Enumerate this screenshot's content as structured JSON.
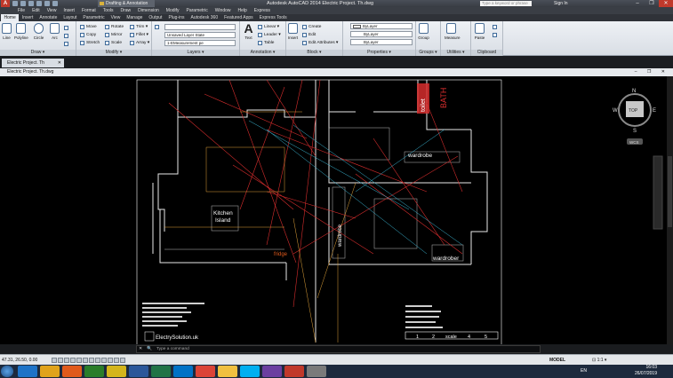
{
  "window": {
    "title": "Autodesk AutoCAD 2014   Electric Project. Th.dwg",
    "workspace": "Drafting & Annotation",
    "search_placeholder": "Type a keyword or phrase",
    "signin": "Sign In",
    "controls": [
      "–",
      "❐",
      "✕"
    ]
  },
  "menubar": [
    "File",
    "Edit",
    "View",
    "Insert",
    "Format",
    "Tools",
    "Draw",
    "Dimension",
    "Modify",
    "Parametric",
    "Window",
    "Help",
    "Express"
  ],
  "ribbon_tabs": [
    "Home",
    "Insert",
    "Annotate",
    "Layout",
    "Parametric",
    "View",
    "Manage",
    "Output",
    "Plug-ins",
    "Autodesk 360",
    "Featured Apps",
    "Express Tools"
  ],
  "ribbon": {
    "draw": {
      "title": "Draw ▾",
      "line": "Line",
      "polyline": "Polyline",
      "circle": "Circle",
      "arc": "Arc"
    },
    "modify": {
      "title": "Modify ▾",
      "move": "Move",
      "rotate": "Rotate",
      "trim": "Trim ▾",
      "copy": "Copy",
      "mirror": "Mirror",
      "fillet": "Fillet ▾",
      "stretch": "Stretch",
      "scale": "Scale",
      "array": "Array ▾"
    },
    "layers": {
      "title": "Layers ▾",
      "state": "Unsaved Layer State",
      "current": "1-EMeasurement pe"
    },
    "annotation": {
      "title": "Annotation ▾",
      "text": "Text",
      "linear": "Linear ▾",
      "leader": "Leader ▾",
      "table": "Table"
    },
    "block": {
      "title": "Block ▾",
      "insert": "Insert",
      "create": "Create",
      "edit": "Edit",
      "edit_attributes": "Edit Attributes ▾"
    },
    "properties": {
      "title": "Properties ▾",
      "color": "ByLayer",
      "linetype": "ByLayer",
      "lineweight": "ByLayer"
    },
    "groups": {
      "title": "Groups ▾",
      "group": "Group"
    },
    "utilities": {
      "title": "Utilities ▾",
      "measure": "Measure"
    },
    "clipboard": {
      "title": "Clipboard",
      "paste": "Paste"
    }
  },
  "doc_tab": {
    "label": "Electric Project. Th",
    "close": "✕"
  },
  "drawing": {
    "title": "Electric Project. Th.dwg",
    "window_controls": "– ❐ ✕",
    "labels": {
      "toilet": "toilet",
      "bath": "BATH",
      "wardrobe1": "wardrobe",
      "wardrobe2": "wardrobe",
      "wardrobe3": "wardrober",
      "kitchen": "Kitchen",
      "island": "Island",
      "fridge": "fridge",
      "brand": "ElectrySolution.uk"
    },
    "scale_bar": [
      "1",
      "2",
      "scale",
      "4",
      "5"
    ],
    "viewcube": {
      "n": "N",
      "s": "S",
      "e": "E",
      "w": "W",
      "top": "TOP",
      "wcs": "WCS"
    }
  },
  "command": {
    "placeholder": "Type a command",
    "buttons": "✕ 🔍"
  },
  "status": {
    "coords": "47.31, 26.50, 0.00",
    "model": "MODEL",
    "scale": "⊡ 1:1 ▾"
  },
  "taskbar": {
    "apps": [
      "ie",
      "explorer",
      "media",
      "chrome-alt",
      "paint",
      "word",
      "excel",
      "outlook",
      "chrome",
      "folder",
      "skype",
      "photos",
      "autocad",
      "notes"
    ],
    "app_colors": [
      "#1e73c7",
      "#e0a31c",
      "#e05a1c",
      "#2a7d2a",
      "#d4b51c",
      "#2b579a",
      "#217346",
      "#0072c6",
      "#db4437",
      "#f0c040",
      "#00aff0",
      "#6b3fa0",
      "#c0392b",
      "#7a7a7a"
    ],
    "lang": "EN",
    "time": "16:03",
    "date": "26/07/2019"
  }
}
